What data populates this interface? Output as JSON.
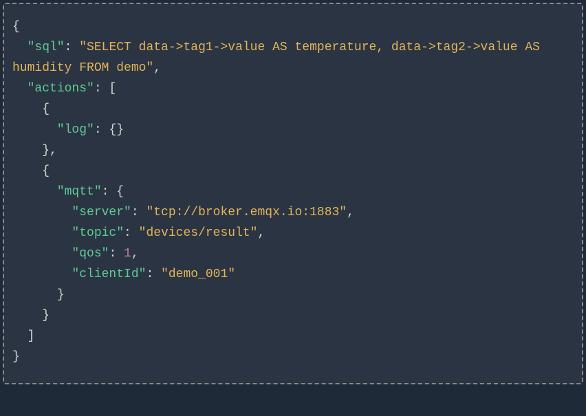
{
  "code": {
    "keys": {
      "sql": "\"sql\"",
      "actions": "\"actions\"",
      "log": "\"log\"",
      "mqtt": "\"mqtt\"",
      "server": "\"server\"",
      "topic": "\"topic\"",
      "qos": "\"qos\"",
      "clientId": "\"clientId\""
    },
    "values": {
      "sql": "\"SELECT data->tag1->value AS temperature, data->tag2->value AS humidity FROM demo\"",
      "server": "\"tcp://broker.emqx.io:1883\"",
      "topic": "\"devices/result\"",
      "qos": "1",
      "clientId": "\"demo_001\""
    },
    "punct": {
      "open_brace": "{",
      "close_brace": "}",
      "open_bracket": "[",
      "close_bracket": "]",
      "colon_space": ": ",
      "comma": ",",
      "empty_obj": "{}"
    },
    "indent": {
      "i1": "  ",
      "i2": "    ",
      "i3": "      ",
      "i4": "        "
    }
  }
}
